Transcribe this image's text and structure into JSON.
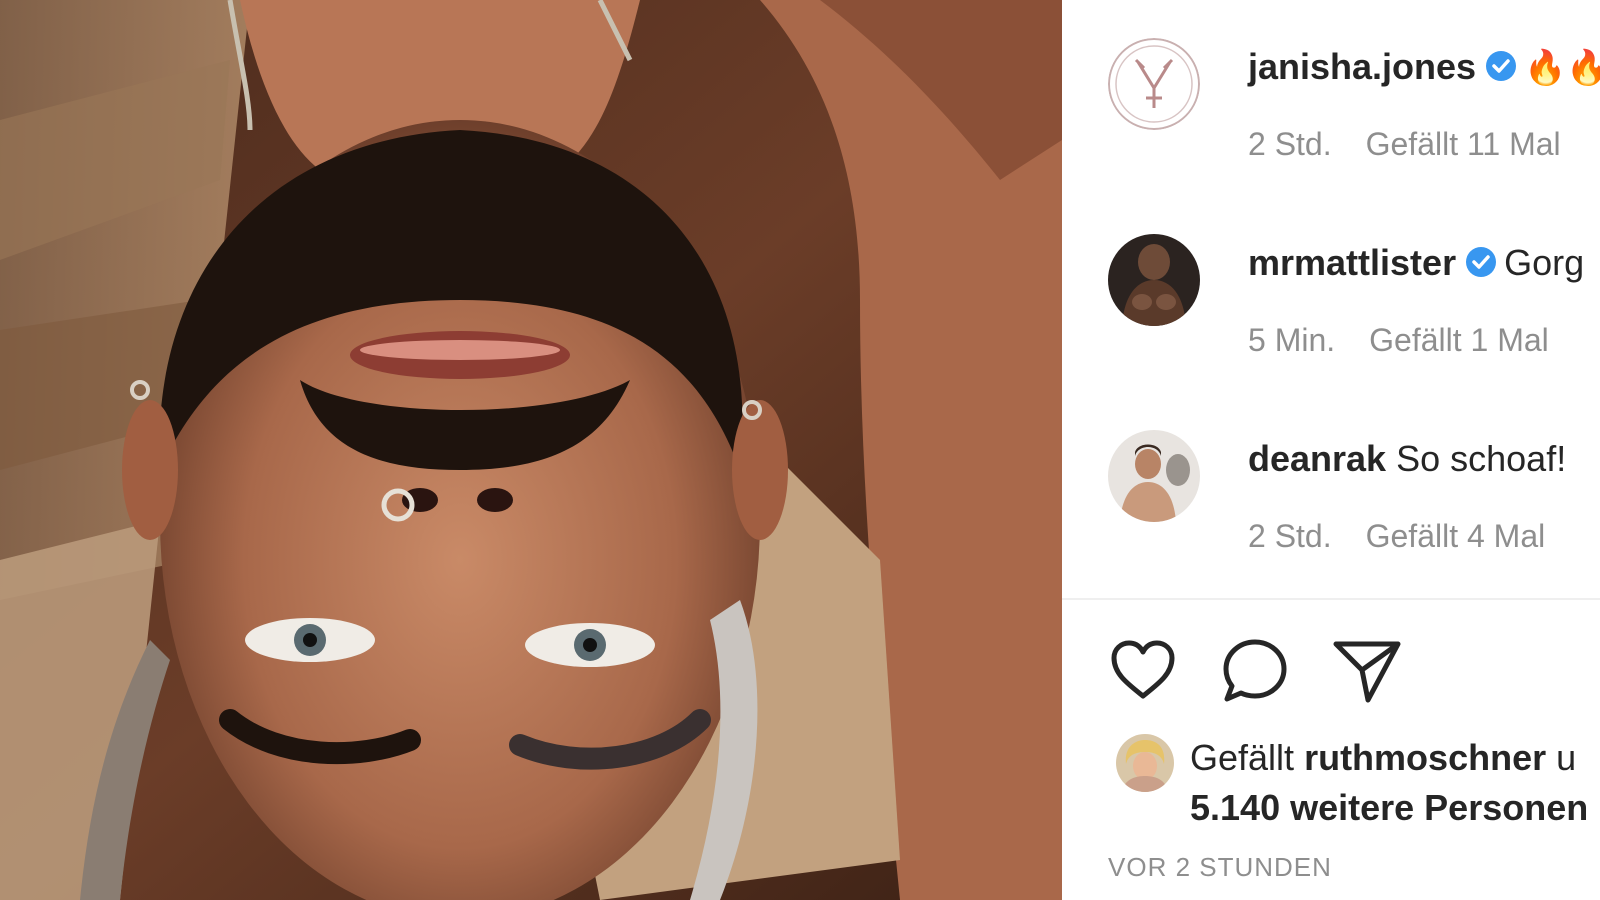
{
  "post": {
    "photo_alt": "upside-down selfie"
  },
  "comments": [
    {
      "username": "janisha.jones",
      "verified": true,
      "text": "🔥🔥",
      "age": "2 Std.",
      "likes": "Gefällt 11 Mal"
    },
    {
      "username": "mrmattlister",
      "verified": true,
      "text": "Gorg",
      "age": "5 Min.",
      "likes": "Gefällt 1 Mal"
    },
    {
      "username": "deanrak",
      "verified": false,
      "text": "So schoaf!",
      "age": "2 Std.",
      "likes": "Gefällt 4 Mal"
    }
  ],
  "actions": {
    "like_icon": "heart-icon",
    "comment_icon": "comment-icon",
    "share_icon": "paper-plane-icon"
  },
  "likes_summary": {
    "prefix": "Gefällt",
    "user": "ruthmoschner",
    "suffix": "u",
    "line2": "5.140 weitere Personen"
  },
  "timestamp": "VOR 2 STUNDEN",
  "colors": {
    "text": "#262626",
    "muted": "#8e8e8e",
    "verified": "#3897f0",
    "divider": "#efefef"
  }
}
